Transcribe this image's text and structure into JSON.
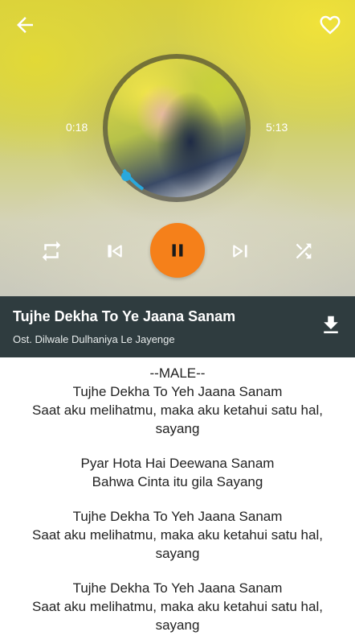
{
  "player": {
    "elapsed": "0:18",
    "total": "5:13",
    "progress_fraction": 0.058,
    "accent_color": "#f5801a",
    "progress_color": "#29a8dc",
    "icons": {
      "back": "arrow-left",
      "favorite": "heart-outline",
      "repeat": "repeat",
      "previous": "skip-previous",
      "play_pause": "pause",
      "next": "skip-next",
      "shuffle": "shuffle",
      "download": "download"
    }
  },
  "song": {
    "title": "Tujhe Dekha To Ye Jaana Sanam",
    "album": "Ost. Dilwale Dulhaniya Le Jayenge"
  },
  "lyrics": {
    "stanzas": [
      [
        "--MALE--",
        "Tujhe Dekha To Yeh Jaana Sanam",
        "Saat aku melihatmu, maka aku ketahui satu hal,",
        "sayang"
      ],
      [
        "Pyar Hota Hai Deewana Sanam",
        "Bahwa Cinta itu gila Sayang"
      ],
      [
        "Tujhe Dekha To Yeh Jaana Sanam",
        "Saat aku melihatmu, maka aku ketahui satu hal,",
        "sayang"
      ],
      [
        "Tujhe Dekha To Yeh Jaana Sanam",
        "Saat aku melihatmu, maka aku ketahui satu hal,",
        "sayang"
      ]
    ]
  }
}
